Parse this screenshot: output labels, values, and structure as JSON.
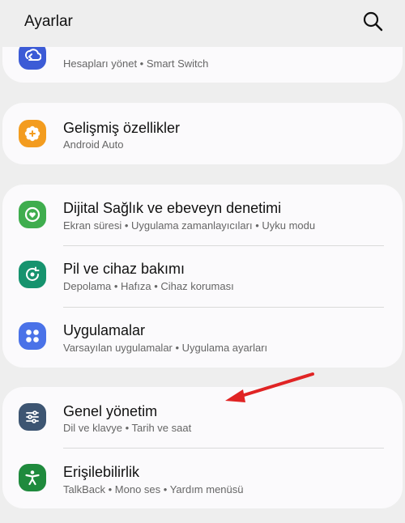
{
  "header": {
    "title": "Ayarlar",
    "search_icon": "search-icon"
  },
  "accounts_row": {
    "subtitle": "Hesapları yönet • Smart Switch",
    "icon": "cloud-sync-icon",
    "icon_color": "#3c5bd6"
  },
  "advanced_row": {
    "title": "Gelişmiş özellikler",
    "subtitle": "Android Auto",
    "icon": "gear-plus-icon",
    "icon_color": "#f39c1f"
  },
  "wellbeing_row": {
    "title": "Dijital Sağlık ve ebeveyn denetimi",
    "subtitle": "Ekran süresi • Uygulama zamanlayıcıları • Uyku modu",
    "icon": "heart-ring-icon",
    "icon_color": "#3fad4e"
  },
  "battery_row": {
    "title": "Pil ve cihaz bakımı",
    "subtitle": "Depolama • Hafıza • Cihaz koruması",
    "icon": "device-care-icon",
    "icon_color": "#16936e"
  },
  "apps_row": {
    "title": "Uygulamalar",
    "subtitle": "Varsayılan uygulamalar • Uygulama ayarları",
    "icon": "apps-grid-icon",
    "icon_color": "#4a72e8"
  },
  "general_row": {
    "title": "Genel yönetim",
    "subtitle": "Dil ve klavye • Tarih ve saat",
    "icon": "sliders-icon",
    "icon_color": "#3d5572"
  },
  "accessibility_row": {
    "title": "Erişilebilirlik",
    "subtitle": "TalkBack • Mono ses • Yardım menüsü",
    "icon": "accessibility-person-icon",
    "icon_color": "#1f8a3d"
  },
  "annotation": {
    "arrow_color": "#e02424"
  }
}
